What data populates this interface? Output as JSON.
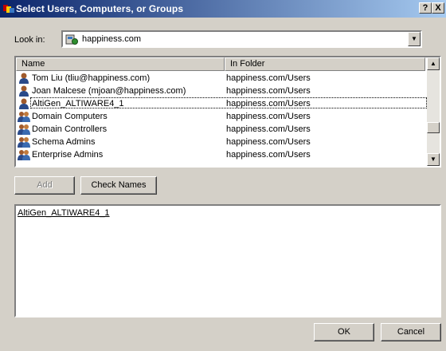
{
  "window": {
    "title": "Select Users, Computers, or Groups",
    "help_button": "?",
    "close_button": "X"
  },
  "lookin": {
    "label": "Look in:",
    "value": "happiness.com"
  },
  "list": {
    "columns": [
      "Name",
      "In Folder"
    ],
    "rows": [
      {
        "name": "Tom Liu (tliu@happiness.com)",
        "folder": "happiness.com/Users",
        "icon": "user-icon"
      },
      {
        "name": "Joan Malcese (mjoan@happiness.com)",
        "folder": "happiness.com/Users",
        "icon": "user-icon"
      },
      {
        "name": "AltiGen_ALTIWARE4_1",
        "folder": "happiness.com/Users",
        "icon": "user-icon"
      },
      {
        "name": "Domain Computers",
        "folder": "happiness.com/Users",
        "icon": "group-icon"
      },
      {
        "name": "Domain Controllers",
        "folder": "happiness.com/Users",
        "icon": "group-icon"
      },
      {
        "name": "Schema Admins",
        "folder": "happiness.com/Users",
        "icon": "group-icon"
      },
      {
        "name": "Enterprise Admins",
        "folder": "happiness.com/Users",
        "icon": "group-icon"
      }
    ]
  },
  "buttons": {
    "add": "Add",
    "check_names": "Check Names",
    "ok": "OK",
    "cancel": "Cancel"
  },
  "selected": {
    "entries": [
      "AltiGen_ALTIWARE4_1"
    ]
  },
  "colors": {
    "title_start": "#0a246a",
    "title_end": "#a6caf0",
    "face": "#d4d0c8"
  }
}
